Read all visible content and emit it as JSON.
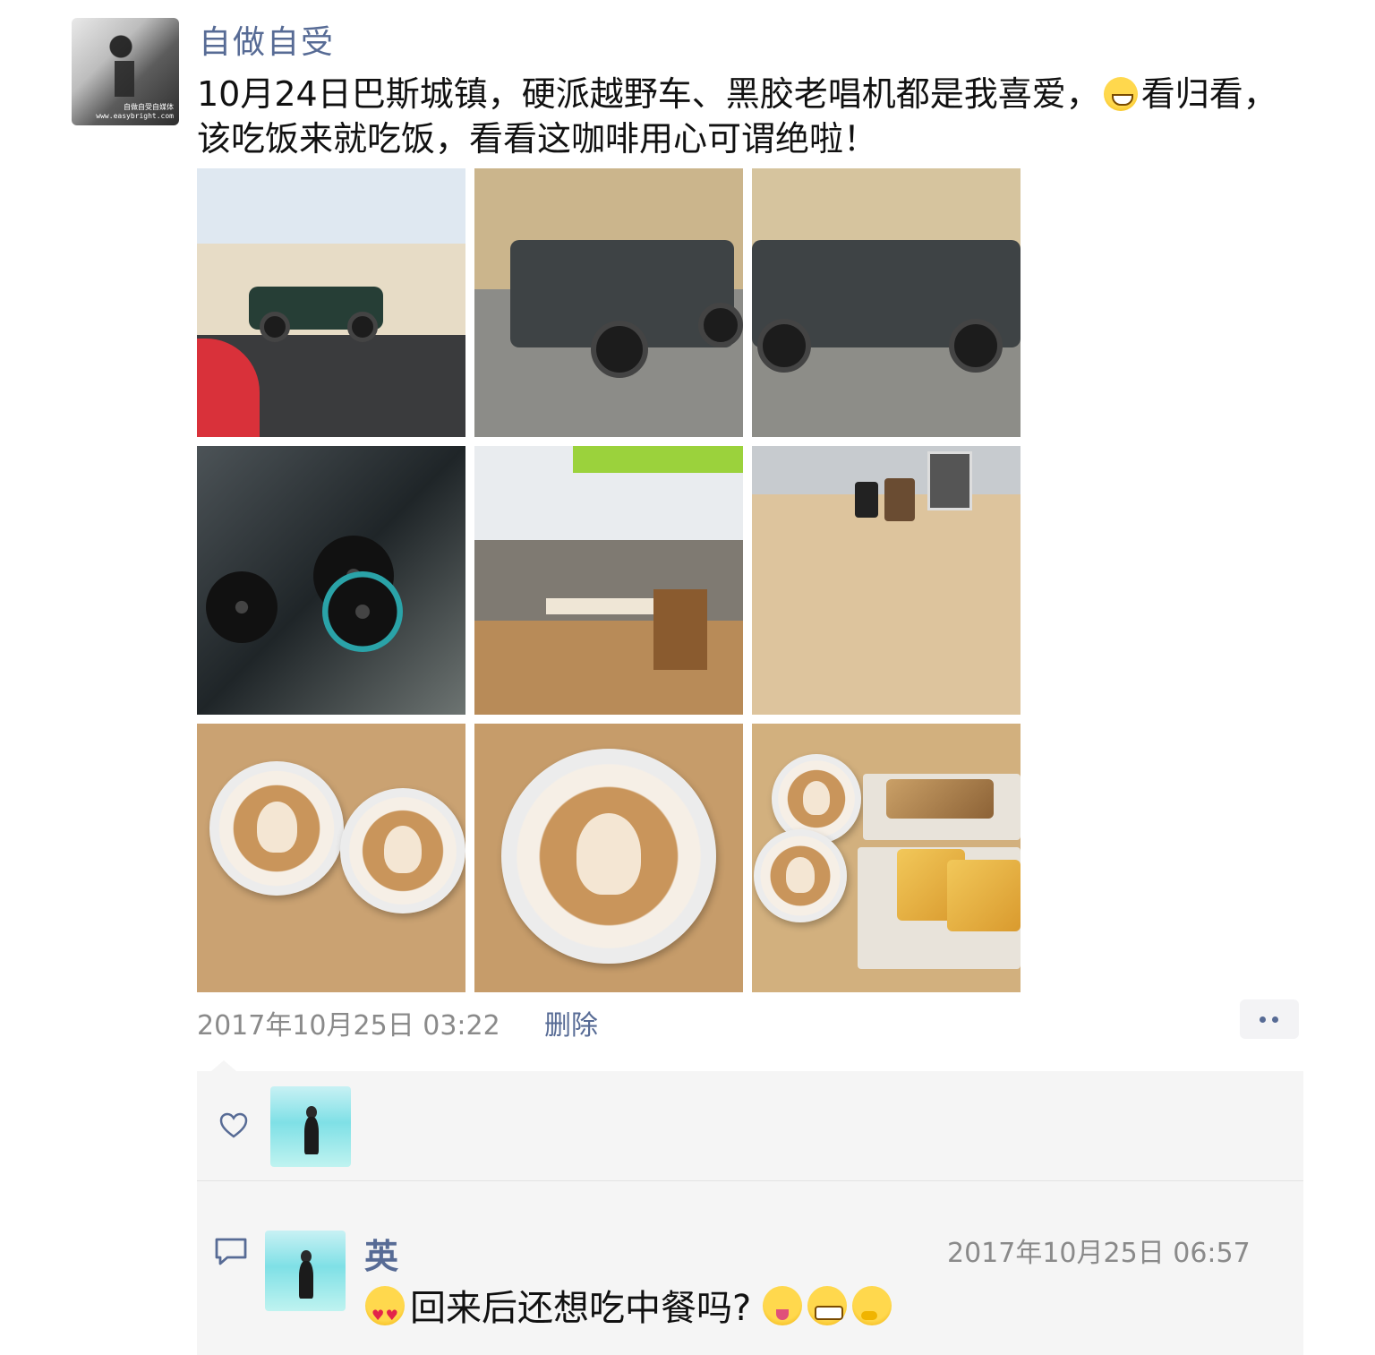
{
  "post": {
    "author": "自做自受",
    "text_before_emoji": "10月24日巴斯城镇，硬派越野车、黑胶老唱机都是我喜爱，",
    "emoji": "grinning-face-emoji",
    "text_after_emoji": "看归看，该吃饭来就吃饭，看看这咖啡用心可谓绝啦！",
    "avatar_caption": "自做自受自媒体 www.easybright.com",
    "timestamp": "2017年10月25日 03:22",
    "delete_label": "删除",
    "photos": [
      "street-land-rover-photo",
      "grey-defender-front-photo",
      "grey-defender-side-photo",
      "turntables-shop-window-photo",
      "cafe-interior-photo",
      "wooden-table-photo",
      "two-lattes-photo",
      "latte-art-closeup-photo",
      "coffee-and-toast-photo"
    ]
  },
  "likes": {
    "icon": "heart-outline-icon",
    "users": [
      "liker-avatar"
    ]
  },
  "comment": {
    "icon": "comment-bubble-icon",
    "author": "英",
    "time": "2017年10月25日 06:57",
    "text": "回来后还想吃中餐吗?",
    "leading_emoji": "heart-eyes-emoji",
    "trailing_emojis": [
      "winking-tongue-emoji",
      "grimacing-emoji",
      "thinking-emoji"
    ]
  },
  "colors": {
    "link": "#576b95",
    "meta": "#8a8a8a",
    "panel": "#f5f5f5"
  }
}
